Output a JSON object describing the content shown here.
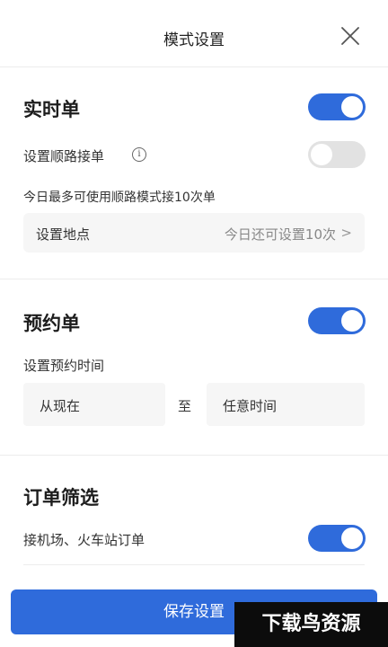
{
  "header": {
    "title": "模式设置",
    "close_icon": "close-icon"
  },
  "realtime": {
    "title": "实时单",
    "toggle_on": true,
    "route_label": "设置顺路接单",
    "route_info_icon": "info-icon",
    "route_toggle_on": false,
    "limit_note": "今日最多可使用顺路模式接10次单",
    "location_label": "设置地点",
    "location_value": "今日还可设置10次",
    "location_chevron": ">"
  },
  "reservation": {
    "title": "预约单",
    "toggle_on": true,
    "time_label": "设置预约时间",
    "from_value": "从现在",
    "to_label": "至",
    "to_value": "任意时间"
  },
  "filter": {
    "title": "订单筛选",
    "airport_label": "接机场、火车站订单",
    "airport_toggle_on": true
  },
  "footer": {
    "save_label": "保存设置",
    "watermark": "下载鸟资源"
  },
  "colors": {
    "accent": "#2f6bdb",
    "toggle_off": "#e2e2e2",
    "box_bg": "#f6f6f6"
  }
}
